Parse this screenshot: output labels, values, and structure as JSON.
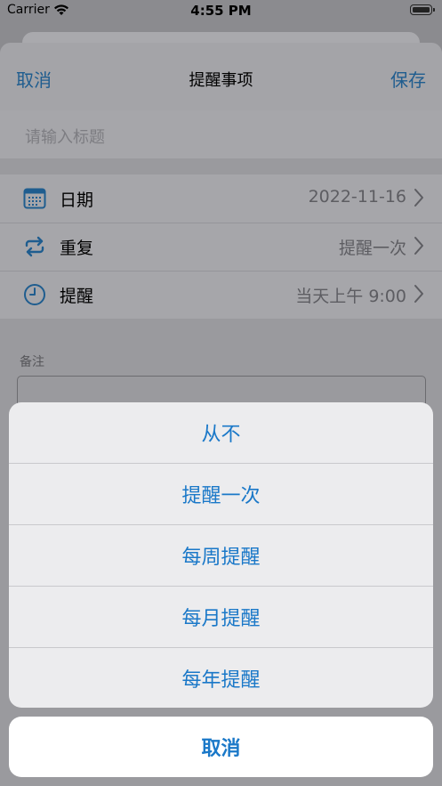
{
  "status_bar": {
    "carrier": "Carrier",
    "time": "4:55 PM"
  },
  "nav": {
    "cancel": "取消",
    "title": "提醒事项",
    "save": "保存"
  },
  "title_field": {
    "placeholder": "请输入标题"
  },
  "rows": [
    {
      "icon": "calendar-icon",
      "label": "日期",
      "value": "2022-11-16"
    },
    {
      "icon": "repeat-icon",
      "label": "重复",
      "value": "提醒一次"
    },
    {
      "icon": "clock-icon",
      "label": "提醒",
      "value": "当天上午 9:00"
    }
  ],
  "note": {
    "label": "备注"
  },
  "action_sheet": {
    "options": [
      "从不",
      "提醒一次",
      "每周提醒",
      "每月提醒",
      "每年提醒"
    ],
    "cancel": "取消"
  },
  "colors": {
    "accent": "#1a78c8",
    "dimmed_accent": "#1f5d8f"
  }
}
